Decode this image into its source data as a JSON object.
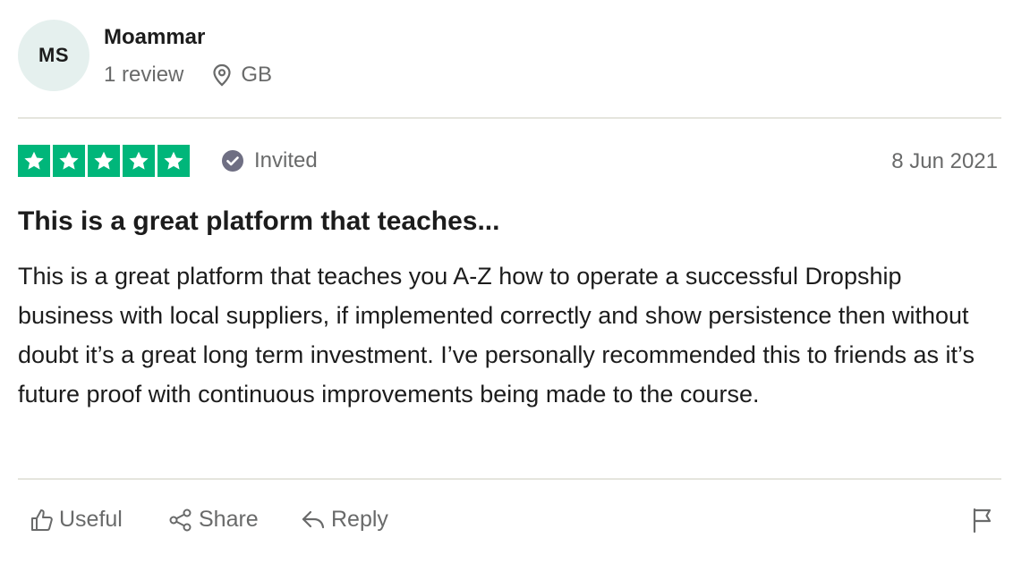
{
  "reviewer": {
    "initials": "MS",
    "name": "Moammar",
    "review_count": "1 review",
    "location": "GB"
  },
  "review": {
    "rating": 5,
    "rating_max": 5,
    "status": "Invited",
    "date": "8 Jun 2021",
    "title": "This is a great platform that teaches...",
    "body": "This is a great platform that teaches you A-Z how to operate a successful Dropship business with local suppliers, if implemented correctly and show persistence then without doubt it’s a great long term investment. I’ve personally recommended this to friends as it’s future proof with continuous improvements being made to the course."
  },
  "actions": {
    "useful": "Useful",
    "share": "Share",
    "reply": "Reply"
  },
  "colors": {
    "star_green": "#00b67a",
    "avatar_bg": "#e5f0ee",
    "muted_text": "#696a6a",
    "verified_icon": "#6f6f83"
  },
  "icons": [
    "location-pin-icon",
    "star-icon",
    "checkmark-circle-icon",
    "thumbs-up-icon",
    "share-icon",
    "reply-icon",
    "flag-icon"
  ]
}
